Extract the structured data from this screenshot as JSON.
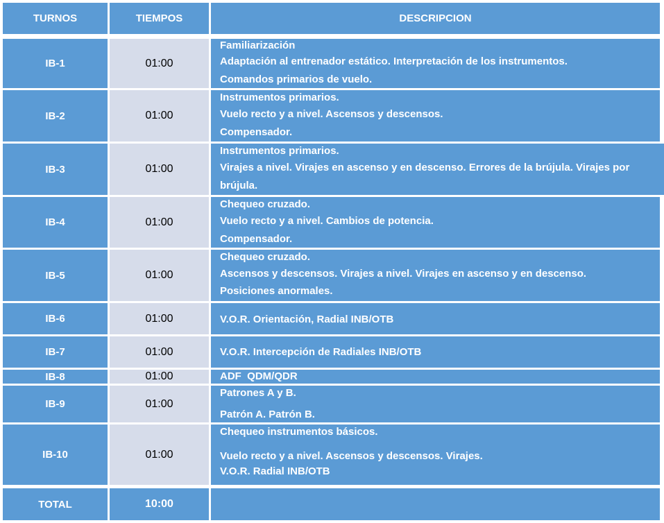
{
  "header": {
    "col_turnos": "TURNOS",
    "col_tiempos": "TIEMPOS",
    "col_descripcion": "DESCRIPCION"
  },
  "rows": [
    {
      "turno": "IB-1",
      "tiempo": "01:00",
      "lines": [
        "Familiarización",
        "Adaptación al entrenador estático. Interpretación de los instrumentos.",
        "Comandos primarios de vuelo."
      ]
    },
    {
      "turno": "IB-2",
      "tiempo": "01:00",
      "lines": [
        "Instrumentos primarios.",
        "Vuelo recto y a nivel. Ascensos y descensos.",
        "Compensador."
      ]
    },
    {
      "turno": "IB-3",
      "tiempo": "01:00",
      "lines": [
        "Instrumentos primarios.",
        "Virajes a nivel. Virajes en ascenso y en descenso. Errores de la brújula. Virajes por",
        "brújula."
      ]
    },
    {
      "turno": "IB-4",
      "tiempo": "01:00",
      "lines": [
        "Chequeo cruzado.",
        "Vuelo recto y a nivel. Cambios de potencia.",
        "Compensador."
      ]
    },
    {
      "turno": "IB-5",
      "tiempo": "01:00",
      "lines": [
        "Chequeo cruzado.",
        "Ascensos y descensos. Virajes a nivel. Virajes en ascenso y en descenso.",
        "Posiciones anormales."
      ]
    },
    {
      "turno": "IB-6",
      "tiempo": "01:00",
      "lines": [
        "V.O.R. Orientación, Radial INB/OTB"
      ]
    },
    {
      "turno": "IB-7",
      "tiempo": "01:00",
      "lines": [
        "V.O.R. Intercepción de Radiales INB/OTB"
      ]
    },
    {
      "turno": "IB-8",
      "tiempo": "01:00",
      "lines": [
        "ADF  QDM/QDR"
      ]
    },
    {
      "turno": "IB-9",
      "tiempo": "01:00",
      "lines": [
        "Patrones A y B.",
        "Patrón A. Patrón B."
      ]
    },
    {
      "turno": "IB-10",
      "tiempo": "01:00",
      "lines": [
        "Chequeo instrumentos básicos.",
        "Vuelo recto y a nivel. Ascensos y descensos. Virajes.",
        "V.O.R. Radial INB/OTB"
      ]
    }
  ],
  "footer": {
    "label": "TOTAL",
    "tiempo": "10:00"
  },
  "colors": {
    "header_blue": "#5b9bd5",
    "time_cell": "#d6dcea"
  }
}
